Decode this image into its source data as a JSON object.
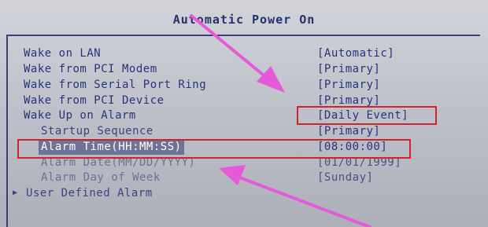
{
  "title": "Automatic Power On",
  "settings": [
    {
      "label": "Wake on LAN",
      "value": "[Automatic]"
    },
    {
      "label": "Wake from PCI Modem",
      "value": "[Primary]"
    },
    {
      "label": "Wake from Serial Port Ring",
      "value": "[Primary]"
    },
    {
      "label": "Wake from PCI Device",
      "value": "[Primary]"
    },
    {
      "label": "Wake Up on Alarm",
      "value": "[Daily Event]"
    },
    {
      "label": "Startup Sequence",
      "value": "[Primary]"
    },
    {
      "label": "Alarm Time(HH:MM:SS)",
      "value": "[08:00:00]"
    },
    {
      "label": "Alarm Date(MM/DD/YYYY)",
      "value": "[01/01/1999]"
    },
    {
      "label": "Alarm Day of Week",
      "value": "[Sunday]"
    },
    {
      "label": "User Defined Alarm",
      "value": ""
    }
  ],
  "colors": {
    "highlight_box": "#d1232b",
    "annotation_arrow": "#e45ad8",
    "text": "#28337a",
    "selection_bg": "#6f7396"
  }
}
